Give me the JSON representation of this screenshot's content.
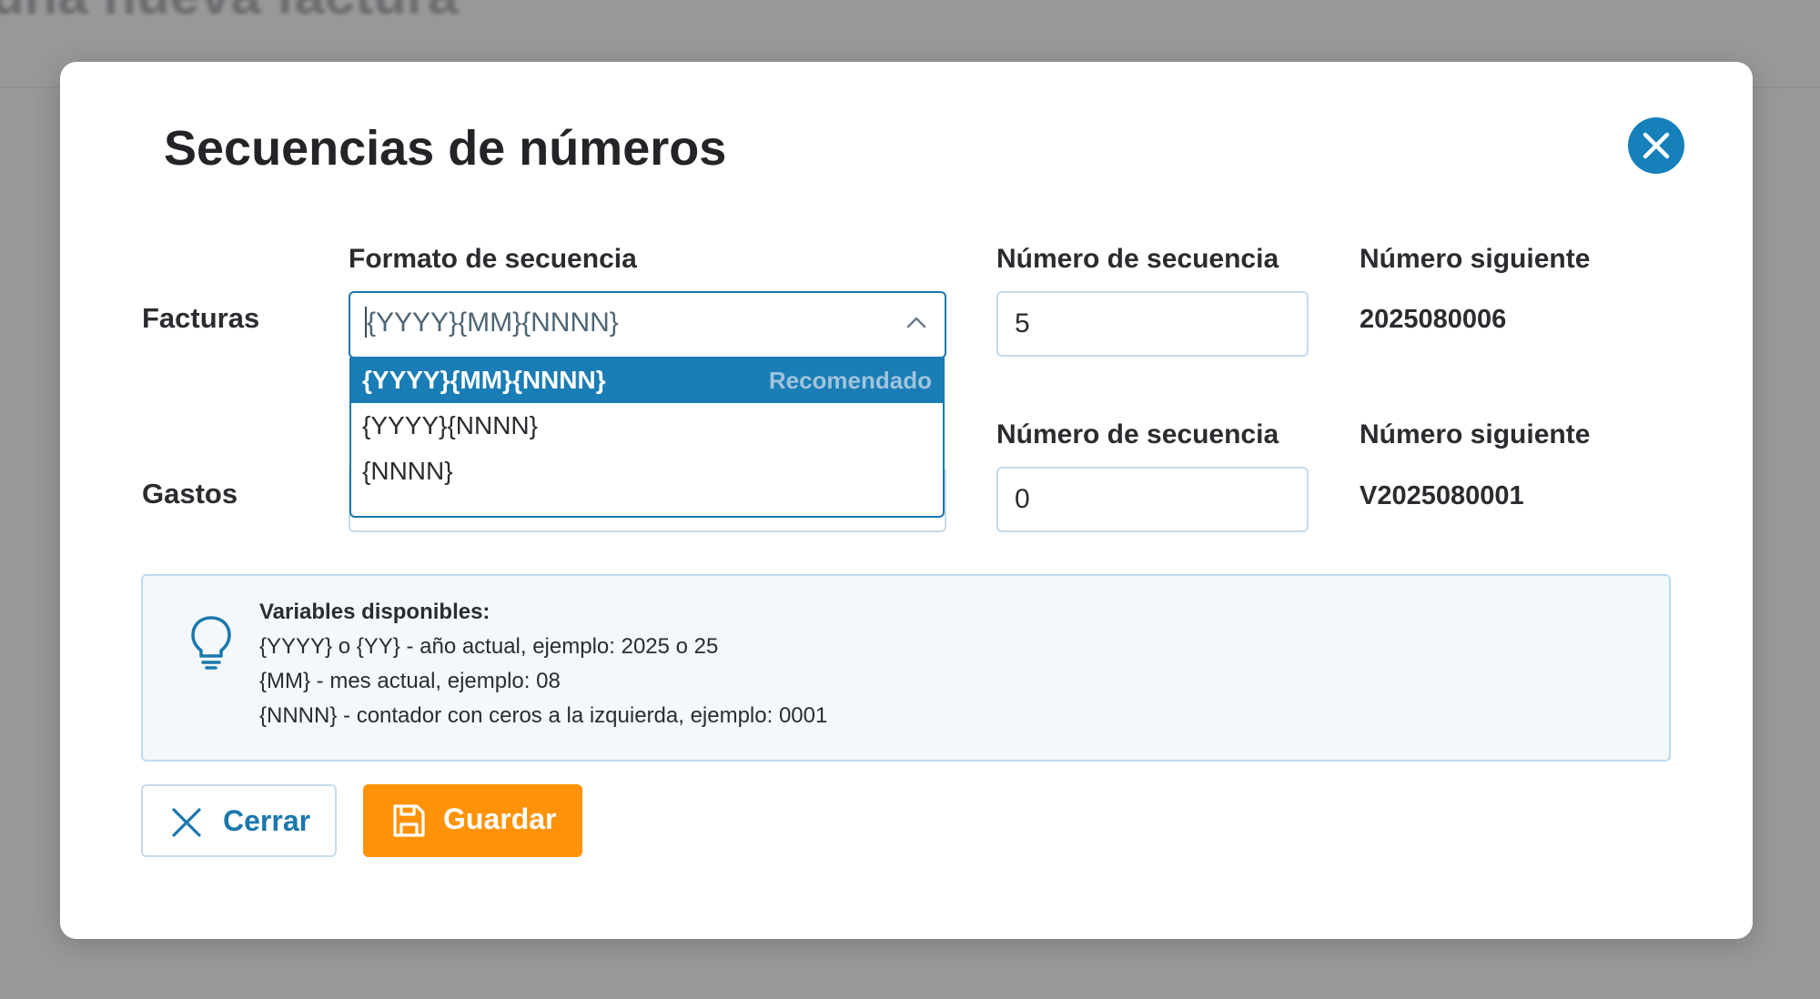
{
  "background": {
    "title_fragment": "una nueva factura"
  },
  "modal": {
    "title": "Secuencias de números",
    "close_icon": "close-icon"
  },
  "columns": {
    "format": "Formato de secuencia",
    "sequence_number": "Número de secuencia",
    "next_number": "Número siguiente"
  },
  "rows": [
    {
      "label": "Facturas",
      "format_value": "{YYYY}{MM}{NNNN}",
      "sequence_number": "5",
      "sequence_header": "Número de secuencia",
      "next_header": "Número siguiente",
      "next_number": "2025080006"
    },
    {
      "label": "Gastos",
      "sequence_number": "0",
      "sequence_header": "Número de secuencia",
      "next_header": "Número siguiente",
      "next_number": "V2025080001"
    }
  ],
  "dropdown": {
    "options": [
      {
        "label": "{YYYY}{MM}{NNNN}",
        "badge": "Recomendado",
        "selected": true
      },
      {
        "label": "{YYYY}{NNNN}",
        "selected": false
      },
      {
        "label": "{NNNN}",
        "selected": false
      }
    ]
  },
  "info": {
    "icon": "lightbulb-icon",
    "title": "Variables disponibles:",
    "lines": [
      "{YYYY} o {YY} - año actual, ejemplo: 2025 o 25",
      "{MM} - mes actual, ejemplo: 08",
      "{NNNN} - contador con ceros a la izquierda, ejemplo: 0001"
    ]
  },
  "buttons": {
    "cancel_label": "Cerrar",
    "save_label": "Guardar"
  },
  "colors": {
    "accent": "#1580ba",
    "save": "#ff9207",
    "backdrop": "#97989a"
  }
}
